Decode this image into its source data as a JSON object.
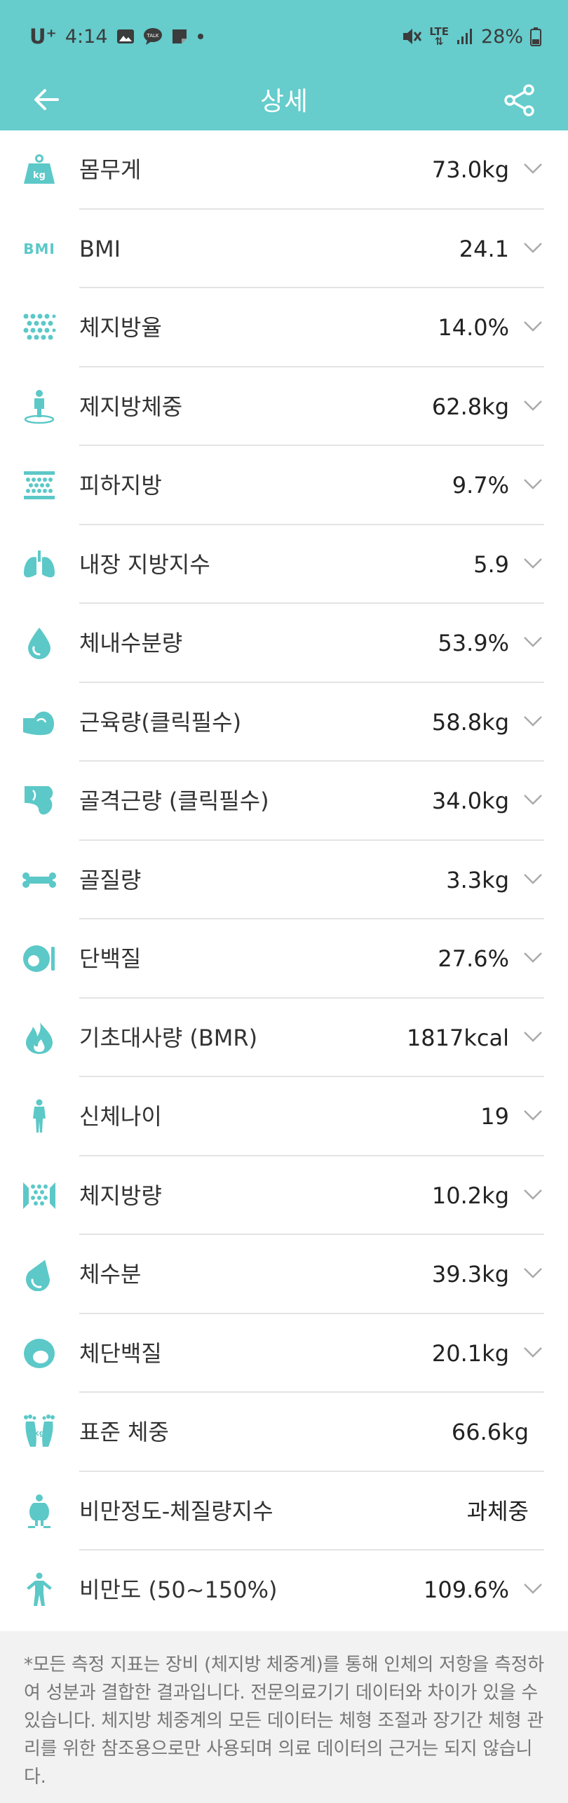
{
  "status": {
    "carrier": "U⁺",
    "time": "4:14",
    "network": "LTE",
    "battery": "28%"
  },
  "header": {
    "title": "상세"
  },
  "accent": "#66cccc",
  "rows": [
    {
      "label": "몸무게",
      "value": "73.0kg",
      "icon": "scale-kg-icon"
    },
    {
      "label": "BMI",
      "value": "24.1",
      "icon": "bmi-icon",
      "icon_text": "BMI"
    },
    {
      "label": "체지방율",
      "value": "14.0%",
      "icon": "fat-dots-icon"
    },
    {
      "label": "제지방체중",
      "value": "62.8kg",
      "icon": "person-pin-icon"
    },
    {
      "label": "피하지방",
      "value": "9.7%",
      "icon": "subcutaneous-fat-icon"
    },
    {
      "label": "내장 지방지수",
      "value": "5.9",
      "icon": "lungs-icon"
    },
    {
      "label": "체내수분량",
      "value": "53.9%",
      "icon": "water-drop-icon"
    },
    {
      "label": "근육량(클릭필수)",
      "value": "58.8kg",
      "icon": "muscle-arm-icon"
    },
    {
      "label": "골격근량 (클릭필수)",
      "value": "34.0kg",
      "icon": "skeletal-muscle-icon"
    },
    {
      "label": "골질량",
      "value": "3.3kg",
      "icon": "bone-icon"
    },
    {
      "label": "단백질",
      "value": "27.6%",
      "icon": "protein-icon"
    },
    {
      "label": "기초대사량 (BMR)",
      "value": "1817kcal",
      "icon": "flame-icon"
    },
    {
      "label": "신체나이",
      "value": "19",
      "icon": "body-figure-icon"
    },
    {
      "label": "체지방량",
      "value": "10.2kg",
      "icon": "fat-mass-icon"
    },
    {
      "label": "체수분",
      "value": "39.3kg",
      "icon": "water-drop-outline-icon"
    },
    {
      "label": "체단백질",
      "value": "20.1kg",
      "icon": "egg-icon"
    },
    {
      "label": "표준 체중",
      "value": "66.6kg",
      "icon": "feet-icon",
      "icon_text": "kg"
    },
    {
      "label": "비만정도-체질량지수",
      "value": "과체중",
      "icon": "obesity-figure-icon"
    },
    {
      "label": "비만도 (50~150%)",
      "value": "109.6%",
      "icon": "stretch-figure-icon"
    }
  ],
  "footer": {
    "note": "*모든 측정 지표는 장비 (체지방 체중계)를 통해 인체의 저항을 측정하여 성분과 결합한 결과입니다. 전문의료기기 데이터와 차이가 있을 수 있습니다. 체지방 체중계의 모든 데이터는 체형 조절과 장기간 체형 관리를 위한 참조용으로만 사용되며 의료 데이터의 근거는 되지 않습니다."
  }
}
